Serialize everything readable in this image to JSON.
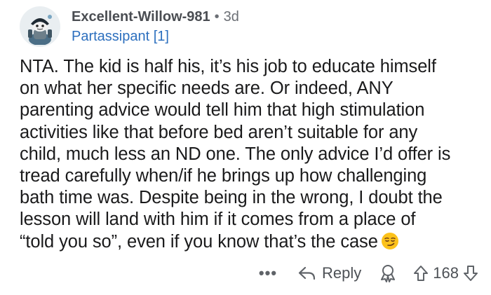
{
  "comment": {
    "author": "Excellent-Willow-981",
    "separator": "•",
    "age": "3d",
    "flair": "Partassipant [1]",
    "body_lines": [
      "NTA. The kid is half his, it’s his job to educate himself",
      "on what her specific needs are. Or indeed, ANY",
      "parenting advice would tell him that high stimulation",
      "activities like that before bed aren’t suitable for any",
      "child, much less an ND one. The only advice I’d offer is",
      "tread carefully when/if he brings up how challenging",
      "bath time was. Despite being in the wrong, I doubt the",
      "lesson will land with him if it comes from a place of",
      "“told you so”, even if you know that’s the case"
    ],
    "emoji": "smirk-emoji"
  },
  "actions": {
    "more_label": "•••",
    "reply_label": "Reply",
    "score": "168"
  },
  "icons": {
    "avatar": "snoo-avatar-icon",
    "more": "more-options-icon",
    "reply": "reply-arrow-icon",
    "award": "award-icon",
    "upvote": "upvote-arrow-icon",
    "downvote": "downvote-arrow-icon"
  },
  "colors": {
    "flair": "#2c6fbe",
    "text": "#1a1a1b",
    "muted": "#6b6f75",
    "avatar_bg": "#e9eef1"
  }
}
